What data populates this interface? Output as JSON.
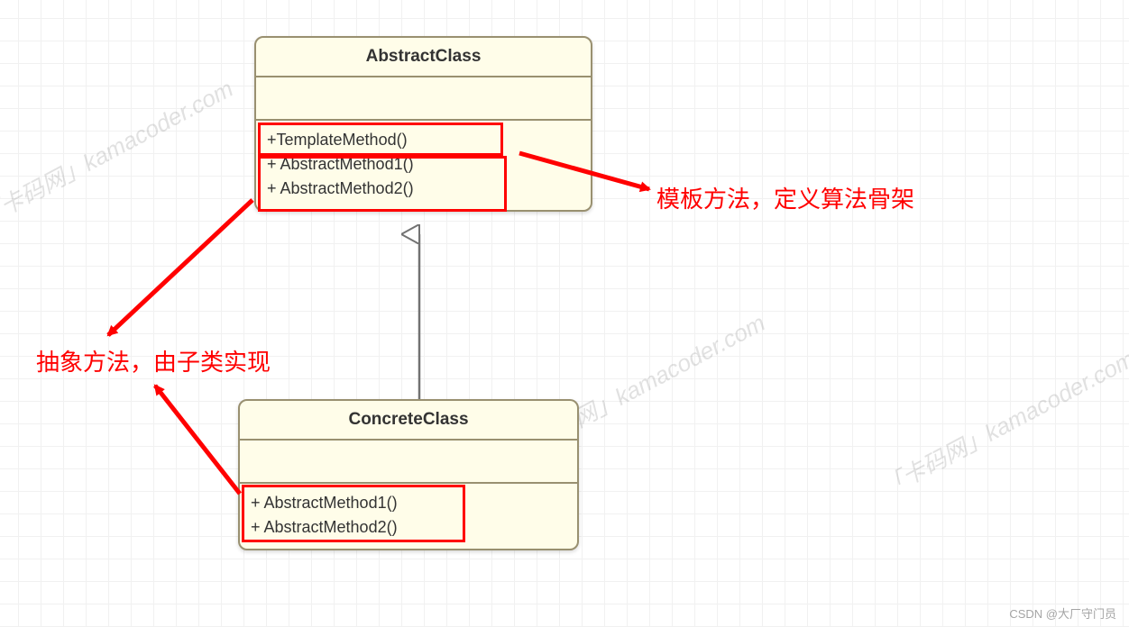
{
  "diagram": {
    "abstract_class": {
      "title": "AbstractClass",
      "methods": {
        "m1": "+TemplateMethod()",
        "m2": "+ AbstractMethod1()",
        "m3": "+ AbstractMethod2()"
      }
    },
    "concrete_class": {
      "title": "ConcreteClass",
      "methods": {
        "m1": "+ AbstractMethod1()",
        "m2": "+ AbstractMethod2()"
      }
    },
    "annotations": {
      "template_note": "模板方法，定义算法骨架",
      "abstract_note": "抽象方法，由子类实现"
    },
    "watermarks": {
      "w1": "「卡码网」kamacoder.com",
      "w2": "「卡码网」kamacoder.com",
      "w3": "「卡码网」kamacoder.com"
    },
    "footer": "CSDN @大厂守门员"
  }
}
